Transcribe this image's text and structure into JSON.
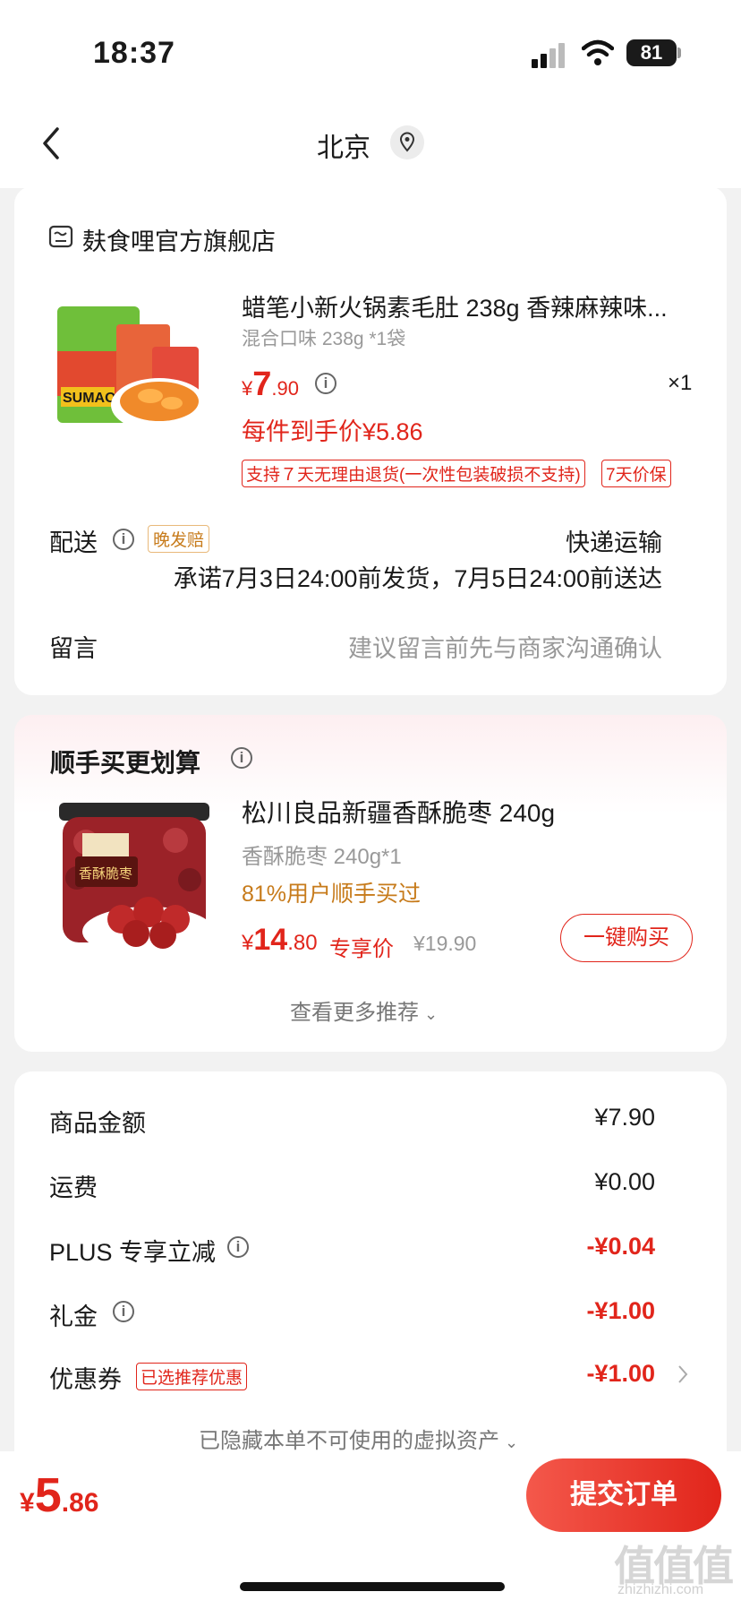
{
  "status": {
    "time": "18:37",
    "battery": "81"
  },
  "nav": {
    "city": "北京"
  },
  "store": {
    "name": "麸食哩官方旗舰店"
  },
  "product": {
    "title": "蜡笔小新火锅素毛肚 238g 香辣麻辣味...",
    "spec": "混合口味 238g *1袋",
    "price_symbol": "¥",
    "price_int": "7",
    "price_dec": ".90",
    "qty": "×1",
    "unit_price": "每件到手价¥5.86",
    "tag_return": "支持７天无理由退货(一次性包装破损不支持)",
    "tag_price": "7天价保"
  },
  "delivery": {
    "label": "配送",
    "badge": "晚发赔",
    "method": "快递运输",
    "promise": "承诺7月3日24:00前发货，7月5日24:00前送达"
  },
  "message": {
    "label": "留言",
    "placeholder": "建议留言前先与商家沟通确认"
  },
  "recommend": {
    "title": "顺手买更划算",
    "name": "松川良品新疆香酥脆枣 240g",
    "spec": "香酥脆枣 240g*1",
    "stat": "81%用户顺手买过",
    "price_symbol": "¥",
    "price_int": "14",
    "price_dec": ".80",
    "price_label": "专享价",
    "orig_price": "¥19.90",
    "buy_button": "一键购买",
    "more": "查看更多推荐"
  },
  "summary": {
    "rows": [
      {
        "label": "商品金额",
        "value": "¥7.90"
      },
      {
        "label": "运费",
        "value": "¥0.00"
      },
      {
        "label": "PLUS 专享立减",
        "value": "-¥0.04"
      },
      {
        "label": "礼金",
        "value": "-¥1.00"
      },
      {
        "label": "优惠券",
        "value": "-¥1.00"
      }
    ],
    "coupon_badge": "已选推荐优惠",
    "hidden_assets": "已隐藏本单不可使用的虚拟资产"
  },
  "footer": {
    "total_symbol": "¥",
    "total_int": "5",
    "total_dec": ".86",
    "submit": "提交订单"
  },
  "watermark": {
    "text": "值值值",
    "url": "zhizhizhi.com"
  }
}
